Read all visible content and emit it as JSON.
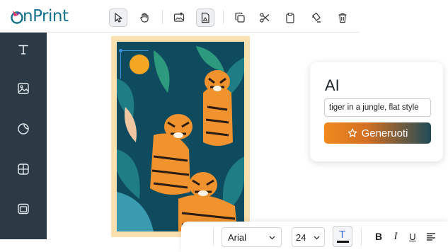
{
  "app": {
    "logo_text": "nPrint",
    "logo_prefix": "o"
  },
  "toolbar": {
    "tools": [
      {
        "name": "select-tool",
        "icon": "cursor-arrow-icon",
        "active": true
      },
      {
        "name": "pan-tool",
        "icon": "hand-icon",
        "active": false
      },
      {
        "name": "image-upload-tool",
        "icon": "image-upload-icon",
        "active": false
      },
      {
        "name": "file-image-tool",
        "icon": "file-image-icon",
        "active": true
      },
      {
        "name": "duplicate-tool",
        "icon": "copy-icon",
        "active": false
      },
      {
        "name": "cut-tool",
        "icon": "scissors-icon",
        "active": false
      },
      {
        "name": "clipboard-tool",
        "icon": "clipboard-icon",
        "active": false
      },
      {
        "name": "fill-tool",
        "icon": "paint-bucket-icon",
        "active": false
      },
      {
        "name": "delete-tool",
        "icon": "trash-icon",
        "active": false
      }
    ]
  },
  "sidebar": {
    "items": [
      {
        "name": "text",
        "icon": "text-icon"
      },
      {
        "name": "image",
        "icon": "image-icon"
      },
      {
        "name": "shapes",
        "icon": "sticker-icon"
      },
      {
        "name": "layout",
        "icon": "layout-grid-icon"
      },
      {
        "name": "background",
        "icon": "frame-icon"
      }
    ]
  },
  "ai_panel": {
    "title": "AI",
    "prompt_value": "tiger in a jungle, flat style",
    "generate_label": "Generuoti"
  },
  "format_bar": {
    "font_family": "Arial",
    "font_size": "24",
    "text_color_glyph": "T",
    "bold_label": "B",
    "italic_label": "I",
    "underline_label": "U",
    "text_color": "#111111",
    "accent": "#3b6fd6"
  },
  "colors": {
    "sidebar": "#2b3a44",
    "brand": "#15718a",
    "art_background": "#fbe0b0",
    "tiger_orange": "#f0922e",
    "leaf_dark": "#0f4b5e",
    "leaf_teal": "#1f7d86"
  }
}
